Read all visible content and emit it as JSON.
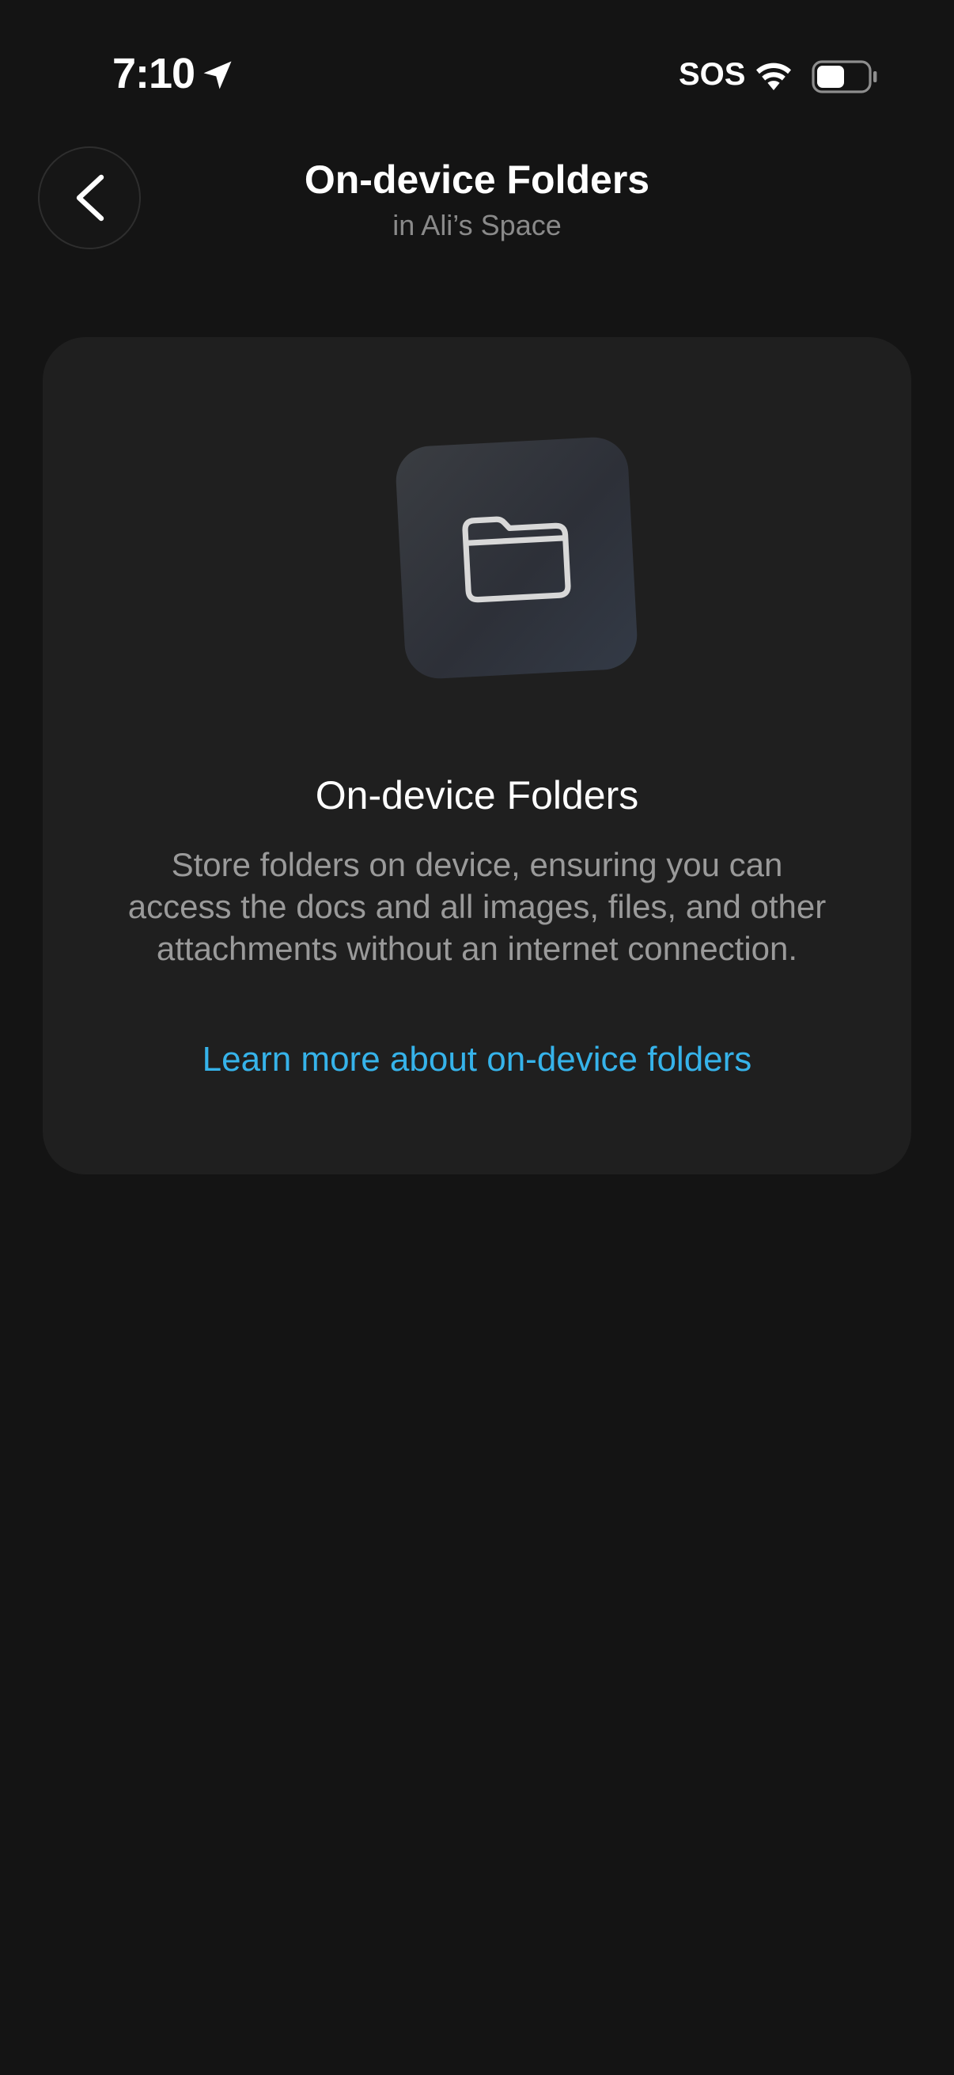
{
  "status_bar": {
    "time": "7:10",
    "sos": "SOS",
    "icons": [
      "location-arrow-icon",
      "wifi-icon",
      "battery-icon"
    ],
    "battery_level": 0.5
  },
  "header": {
    "back_icon": "chevron-left-icon",
    "title": "On-device Folders",
    "subtitle": "in Ali’s Space"
  },
  "card": {
    "icon": "folder-icon",
    "title": "On-device Folders",
    "description": "Store folders on device, ensuring you can access the docs and all images, files, and other attachments without an internet connection.",
    "link_label": "Learn more about on-device folders"
  },
  "colors": {
    "background": "#141414",
    "card": "#1f1f1f",
    "link": "#36b3ea",
    "secondary_text": "#9a9a9a"
  }
}
